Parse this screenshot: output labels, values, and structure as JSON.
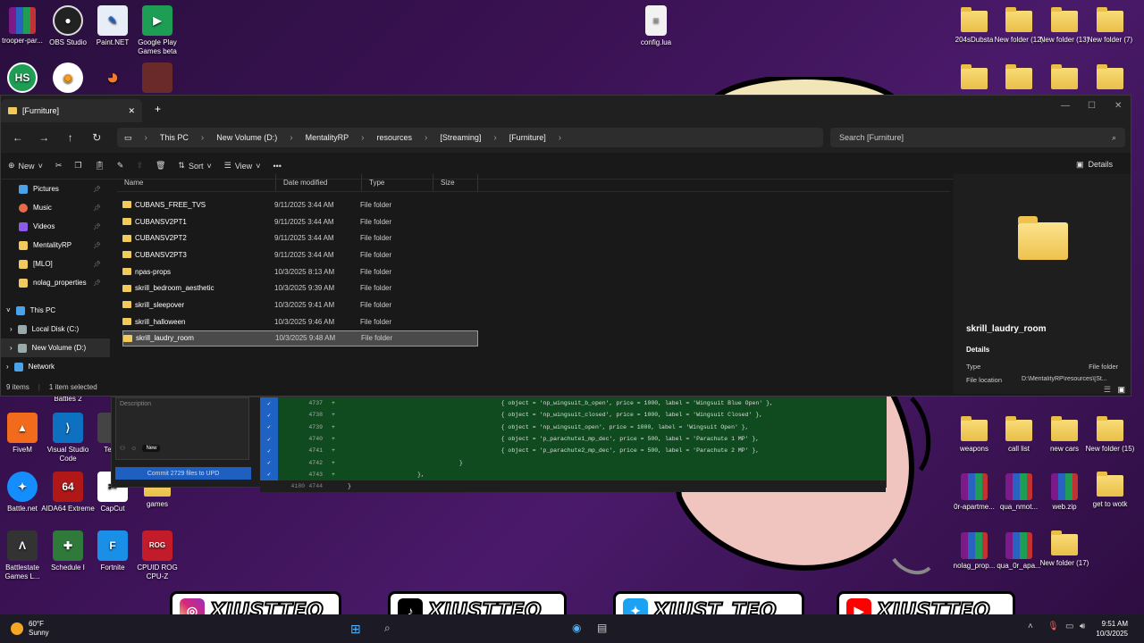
{
  "desktop": {
    "icons_left": [
      {
        "label": "trooper-par..."
      },
      {
        "label": "OBS Studio"
      },
      {
        "label": "Paint.NET"
      },
      {
        "label": "Google Play Games beta"
      },
      {
        "label": "Battles 2"
      },
      {
        "label": "FiveM"
      },
      {
        "label": "Visual Studio Code"
      },
      {
        "label": "Team"
      },
      {
        "label": "Battle.net"
      },
      {
        "label": "AIDA64 Extreme"
      },
      {
        "label": "CapCut"
      },
      {
        "label": "games"
      },
      {
        "label": "Battlestate Games L..."
      },
      {
        "label": "Schedule I"
      },
      {
        "label": "Fortnite"
      },
      {
        "label": "CPUID ROG CPU-Z"
      }
    ],
    "config_file": "config.lua",
    "icons_right_top": [
      {
        "label": "204sDubsta"
      },
      {
        "label": "New folder (12)"
      },
      {
        "label": "New folder (13)"
      },
      {
        "label": "New folder (7)"
      }
    ],
    "icons_right_mid": [
      {
        "label": "weapons"
      },
      {
        "label": "call list"
      },
      {
        "label": "new cars"
      },
      {
        "label": "New folder (15)"
      }
    ],
    "icons_right_low": [
      {
        "label": "0r-apartme..."
      },
      {
        "label": "qua_nmot..."
      },
      {
        "label": "web.zip"
      },
      {
        "label": "get to wotk"
      }
    ],
    "icons_right_bottom": [
      {
        "label": "nolag_prop..."
      },
      {
        "label": "qua_0r_apa..."
      },
      {
        "label": "New folder (17)"
      }
    ]
  },
  "explorer": {
    "tab_title": "[Furniture]",
    "breadcrumbs": [
      "This PC",
      "New Volume (D:)",
      "MentalityRP",
      "resources",
      "[Streaming]",
      "[Furniture]"
    ],
    "search_placeholder": "Search [Furniture]",
    "toolbar": {
      "new": "New",
      "sort": "Sort",
      "view": "View",
      "details": "Details"
    },
    "sidebar": [
      {
        "label": "Pictures",
        "color": "#4aa3e8",
        "pinned": true
      },
      {
        "label": "Music",
        "color": "#e86a4a",
        "pinned": true
      },
      {
        "label": "Videos",
        "color": "#8a5ae8",
        "pinned": true
      },
      {
        "label": "MentalityRP",
        "color": "#f0ca5a",
        "pinned": true
      },
      {
        "label": "[MLO]",
        "color": "#f0ca5a",
        "pinned": true
      },
      {
        "label": "nolag_properties",
        "color": "#f0ca5a",
        "pinned": true
      },
      {
        "label": "This PC",
        "color": "#4aa3e8",
        "pinned": false
      },
      {
        "label": "Local Disk (C:)",
        "color": "#9aa",
        "pinned": false
      },
      {
        "label": "New Volume (D:)",
        "color": "#9aa",
        "pinned": false
      },
      {
        "label": "Network",
        "color": "#4aa3e8",
        "pinned": false
      }
    ],
    "columns": {
      "name": "Name",
      "date": "Date modified",
      "type": "Type",
      "size": "Size"
    },
    "files": [
      {
        "name": "CUBANS_FREE_TVS",
        "date": "9/11/2025 3:44 AM",
        "type": "File folder"
      },
      {
        "name": "CUBANSV2PT1",
        "date": "9/11/2025 3:44 AM",
        "type": "File folder"
      },
      {
        "name": "CUBANSV2PT2",
        "date": "9/11/2025 3:44 AM",
        "type": "File folder"
      },
      {
        "name": "CUBANSV2PT3",
        "date": "9/11/2025 3:44 AM",
        "type": "File folder"
      },
      {
        "name": "npas-props",
        "date": "10/3/2025 8:13 AM",
        "type": "File folder"
      },
      {
        "name": "skrill_bedroom_aesthetic",
        "date": "10/3/2025 9:39 AM",
        "type": "File folder"
      },
      {
        "name": "skrill_sleepover",
        "date": "10/3/2025 9:41 AM",
        "type": "File folder"
      },
      {
        "name": "skrill_halloween",
        "date": "10/3/2025 9:46 AM",
        "type": "File folder"
      },
      {
        "name": "skrill_laudry_room",
        "date": "10/3/2025 9:48 AM",
        "type": "File folder"
      }
    ],
    "status": {
      "items": "9 items",
      "selected": "1 item selected"
    },
    "preview": {
      "name": "skrill_laudry_room",
      "details_heading": "Details",
      "type_label": "Type",
      "type_value": "File folder",
      "location_label": "File location",
      "location_value": "D:\\MentalityRP\\resources\\[St..."
    }
  },
  "editor": {
    "description_placeholder": "Description",
    "new_badge": "New",
    "commit_button": "Commit 2729 files to UPD",
    "lines": [
      {
        "num": "4737",
        "text": "                                            { object = 'np_wingsuit_b_open', price = 1000, label = 'Wingsuit Blue Open' },"
      },
      {
        "num": "4738",
        "text": "                                            { object = 'np_wingsuit_closed', price = 1000, label = 'Wingsuit Closed' },"
      },
      {
        "num": "4739",
        "text": "                                            { object = 'np_wingsuit_open', price = 1000, label = 'Wingsuit Open' },"
      },
      {
        "num": "4740",
        "text": "                                            { object = 'p_parachute1_mp_dec', price = 500, label = 'Parachute 1 MP' },"
      },
      {
        "num": "4741",
        "text": "                                            { object = 'p_parachute2_mp_dec', price = 500, label = 'Parachute 2 MP' },"
      },
      {
        "num": "4742",
        "text": "                                }"
      },
      {
        "num": "4743",
        "text": "                    },"
      }
    ],
    "last_line": {
      "old": "4180",
      "new": "4744",
      "text": "}"
    }
  },
  "socials": [
    {
      "handle": "XJUSTTEO",
      "icon": "instagram-icon",
      "color": "#d6249f"
    },
    {
      "handle": "XJUSTTEO",
      "icon": "tiktok-icon",
      "color": "#000000"
    },
    {
      "handle": "XJUST_TEO",
      "icon": "twitter-icon",
      "color": "#1da1f2"
    },
    {
      "handle": "XJUSTTEO",
      "icon": "youtube-icon",
      "color": "#ff0000"
    }
  ],
  "taskbar": {
    "weather_temp": "60°F",
    "weather_desc": "Sunny",
    "time": "9:51 AM",
    "date": "10/3/2025"
  }
}
